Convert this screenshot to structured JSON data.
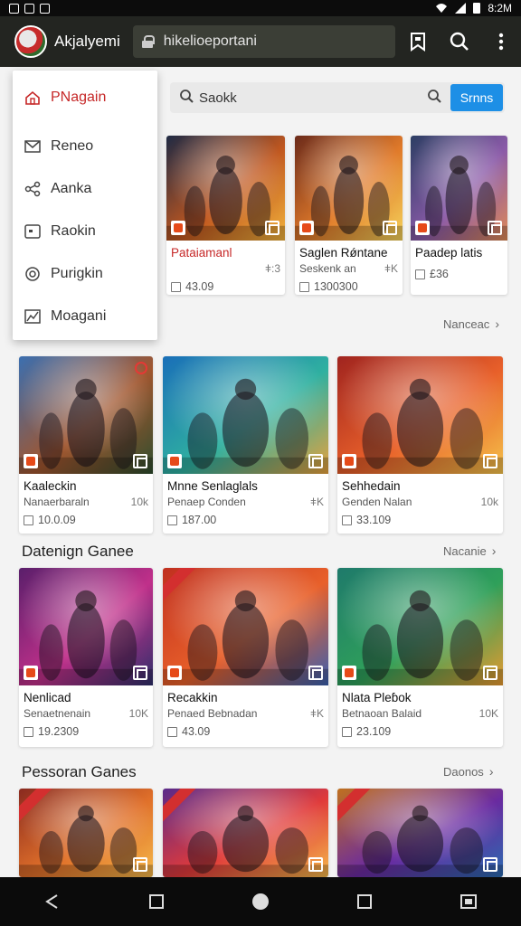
{
  "status_bar": {
    "right_text": "8:2M"
  },
  "app_bar": {
    "title": "Akjalyemi",
    "url": "hikelioeportani"
  },
  "search": {
    "label": "Saokk",
    "button": "Srnns"
  },
  "menu": [
    {
      "label": "PNagain",
      "icon": "home-icon"
    },
    {
      "label": "Reneo",
      "icon": "mail-icon"
    },
    {
      "label": "Aanka",
      "icon": "share-icon"
    },
    {
      "label": "Raokin",
      "icon": "box-icon"
    },
    {
      "label": "Purigkin",
      "icon": "circle-icon"
    },
    {
      "label": "Moagani",
      "icon": "chart-icon"
    }
  ],
  "top_cards": [
    {
      "title": "Pataiamanl",
      "subtitle": "",
      "meta": "ǂ:3",
      "stat": "43.09"
    },
    {
      "title": "Saglen Rǿntane",
      "subtitle": "Seskenk an",
      "meta": "ǂK",
      "stat": "1300300"
    },
    {
      "title": "Paadep latis",
      "subtitle": "",
      "meta": "",
      "stat": "£36"
    }
  ],
  "sections": [
    {
      "title": "",
      "link": "Nanceac",
      "cards": [
        {
          "title": "Kaaleckin",
          "subtitle": "Nanaerbaraln",
          "meta": "10k",
          "stat": "10.0.09"
        },
        {
          "title": "Mnne Senlaglals",
          "subtitle": "Penaep Conden",
          "meta": "ǂK",
          "stat": "187.00"
        },
        {
          "title": "Sehhedain",
          "subtitle": "Genden Nalan",
          "meta": "10k",
          "stat": "33.109"
        }
      ]
    },
    {
      "title": "Datenign Ganee",
      "link": "Nacanie",
      "cards": [
        {
          "title": "Nenlicad",
          "subtitle": "Senaetnenain",
          "meta": "10K",
          "stat": "19.2309"
        },
        {
          "title": "Recakkin",
          "subtitle": "Penaed Bebnadan",
          "meta": "ǂK",
          "stat": "43.09"
        },
        {
          "title": "Nlata Pleɓok",
          "subtitle": "Betnaoan Balaid",
          "meta": "10K",
          "stat": "23.109"
        }
      ]
    },
    {
      "title": "Pessoran Ganes",
      "link": "Daonos",
      "cards": [
        {
          "title": "",
          "subtitle": "",
          "meta": "",
          "stat": ""
        },
        {
          "title": "",
          "subtitle": "",
          "meta": "",
          "stat": ""
        },
        {
          "title": "",
          "subtitle": "",
          "meta": "",
          "stat": ""
        }
      ]
    }
  ],
  "colors": {
    "app_bar": "#232521",
    "accent_blue": "#1d8fe6",
    "accent_red": "#c62828"
  }
}
